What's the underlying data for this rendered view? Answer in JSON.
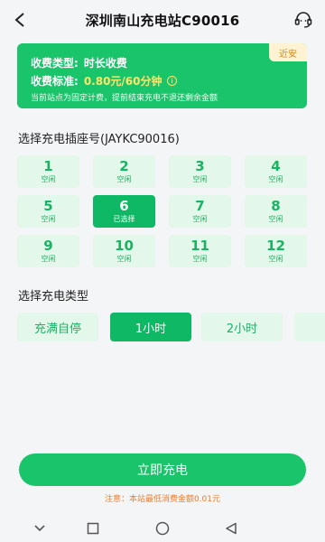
{
  "header": {
    "title": "深圳南山充电站C90016",
    "back_icon": "chevron-left-icon",
    "service_icon": "customer-service-icon"
  },
  "fee_card": {
    "type_label": "收费类型:",
    "type_value": "时长收费",
    "standard_label": "收费标准:",
    "standard_value": "0.80元/60分钟",
    "note": "当前站点为固定计费，提前结束充电不退还剩余金额",
    "badge": "近安",
    "colors": {
      "background": "#19c46b",
      "price": "#ffe66b"
    }
  },
  "port_section": {
    "title": "选择充电插座号(JAYKC90016)",
    "ports": [
      {
        "number": "1",
        "status": "空闲",
        "selected": false
      },
      {
        "number": "2",
        "status": "空闲",
        "selected": false
      },
      {
        "number": "3",
        "status": "空闲",
        "selected": false
      },
      {
        "number": "4",
        "status": "空闲",
        "selected": false
      },
      {
        "number": "5",
        "status": "空闲",
        "selected": false
      },
      {
        "number": "6",
        "status": "已选择",
        "selected": true
      },
      {
        "number": "7",
        "status": "空闲",
        "selected": false
      },
      {
        "number": "8",
        "status": "空闲",
        "selected": false
      },
      {
        "number": "9",
        "status": "空闲",
        "selected": false
      },
      {
        "number": "10",
        "status": "空闲",
        "selected": false
      },
      {
        "number": "11",
        "status": "空闲",
        "selected": false
      },
      {
        "number": "12",
        "status": "空闲",
        "selected": false
      }
    ]
  },
  "type_section": {
    "title": "选择充电类型",
    "options": [
      {
        "label": "充满自停",
        "selected": false
      },
      {
        "label": "1小时",
        "selected": true
      },
      {
        "label": "2小时",
        "selected": false
      },
      {
        "label": "",
        "selected": false
      }
    ]
  },
  "actions": {
    "charge_label": "立即充电",
    "notice": "注意：本站最低消费金额0.01元"
  },
  "nav": {
    "icons": [
      "chevron-down-icon",
      "square-icon",
      "circle-icon",
      "triangle-back-icon"
    ]
  },
  "colors": {
    "accent": "#19c46b",
    "accent_light": "#e3f7ea",
    "notice": "#ee7d2b"
  }
}
